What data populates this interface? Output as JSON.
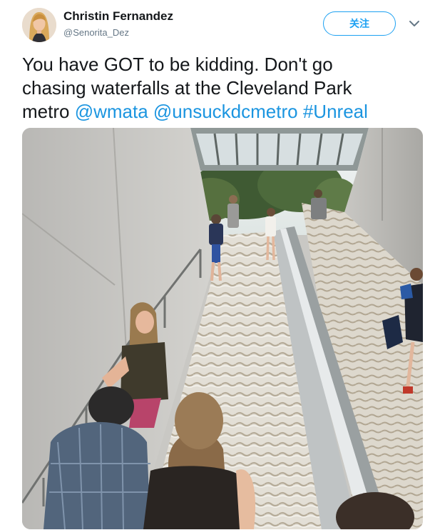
{
  "author": {
    "name": "Christin Fernandez",
    "handle": "@Senorita_Dez",
    "avatar_icon": "profile-avatar"
  },
  "follow_button": {
    "label": "关注",
    "color": "#1da1f2"
  },
  "menu_icon": "chevron-down-icon",
  "tweet": {
    "line1": "You have GOT to be kidding. Don't go",
    "line2": "chasing waterfalls at the Cleveland Park",
    "line3_text": "metro ",
    "mention1": "@wmata",
    "mention2": "@unsuckdcmetro",
    "hashtag": "#Unreal",
    "link_color": "#1b95e0"
  },
  "media": {
    "icon": "photo-flooded-metro-stairs"
  }
}
